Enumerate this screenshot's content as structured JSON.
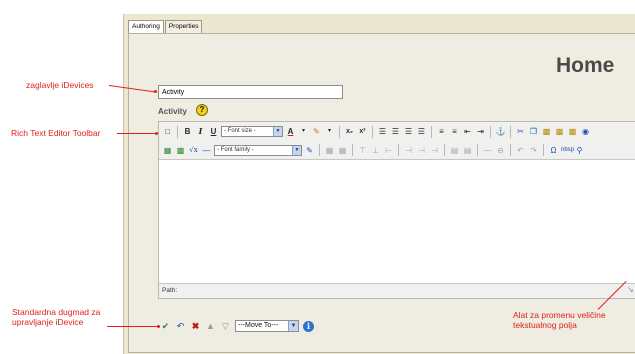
{
  "tabs": [
    {
      "label": "Authoring",
      "active": true
    },
    {
      "label": "Properties",
      "active": false
    }
  ],
  "page_title": "Home",
  "idevice": {
    "title_value": "Activity",
    "field_label": "Activity",
    "help_glyph": "?"
  },
  "toolbar_row1": {
    "font_size_select": "- Font size -"
  },
  "toolbar_row2": {
    "font_family_select": "- Font family -"
  },
  "path_bar_label": "Path:",
  "actions": {
    "move_to_select": "---Move To---",
    "info_glyph": "i"
  },
  "annotations": {
    "title_header": "zaglavlje iDevices",
    "rte_toolbar": "Rich Text Editor Toolbar",
    "standard_buttons_line1": "Standardna dugmad za",
    "standard_buttons_line2": "upravljanje iDevice",
    "resize_tool_line1": "Alat za promenu veličine",
    "resize_tool_line2": "tekstualnog polja"
  },
  "colors": {
    "annotation_red": "#e0201b",
    "frame_bg": "#ece7d0",
    "toolbar_bg": "#f0f0ee"
  }
}
